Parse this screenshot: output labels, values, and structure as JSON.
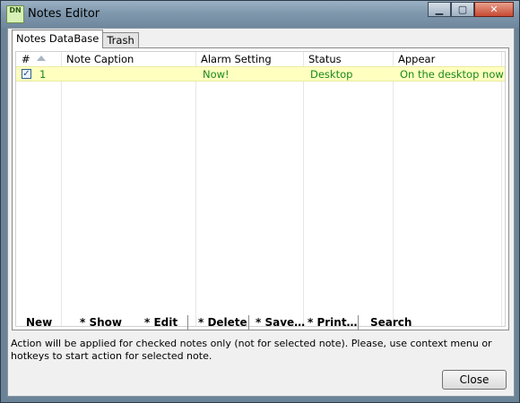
{
  "window": {
    "title": "Notes Editor",
    "icon_label": "DN",
    "buttons": {
      "minimize": "▁",
      "maximize": "▢",
      "close": "✕"
    }
  },
  "tabs": [
    {
      "label": "Notes DataBase",
      "active": true
    },
    {
      "label": "Trash",
      "active": false
    }
  ],
  "table": {
    "columns": [
      "#",
      "Note Caption",
      "Alarm Setting",
      "Status",
      "Appear"
    ],
    "rows": [
      {
        "checked": true,
        "number": "1",
        "caption": "",
        "alarm": "Now!",
        "status": "Desktop",
        "appear": "On the desktop now"
      }
    ],
    "check_glyph": "✓",
    "row_highlight_color": "#ffffc0",
    "row_text_color": "#1a8a1a"
  },
  "toolbar": {
    "new": "New",
    "show": "* Show",
    "edit": "* Edit",
    "delete": "* Delete",
    "save": "* Save…",
    "print": "* Print…",
    "search": "Search"
  },
  "info_text": "Action will be applied for checked notes only (not for selected note). Please, use context menu or hotkeys to start action for selected note.",
  "close_button": "Close"
}
